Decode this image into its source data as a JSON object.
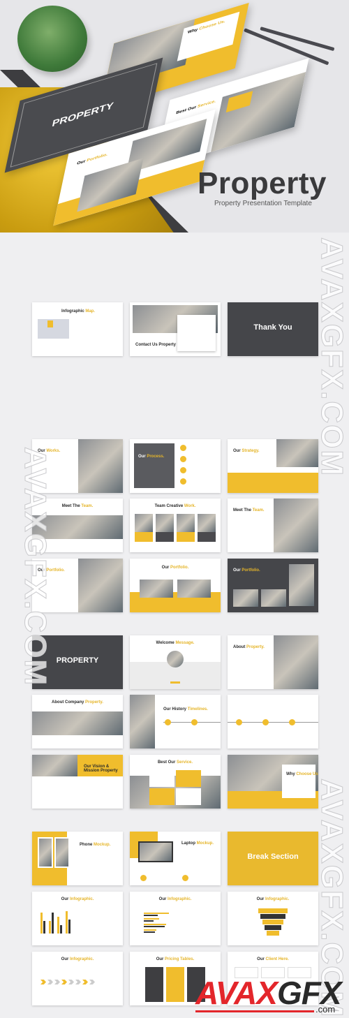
{
  "hero": {
    "title": "Property",
    "subtitle": "Property Presentation Template",
    "mockups": [
      {
        "title_a": "Why",
        "title_b": "Choose Us."
      },
      {
        "title_a": "Best Our",
        "title_b": "Service."
      },
      {
        "title_a": "PROPERTY",
        "title_b": ""
      },
      {
        "title_a": "Our",
        "title_b": "Portfolio."
      }
    ]
  },
  "colors": {
    "accent": "#f0bd2d",
    "dark": "#3f3f42",
    "watermark_red": "#e3262b"
  },
  "slides": [
    {
      "title_a": "Infographic",
      "title_b": "Map.",
      "layout": "map"
    },
    {
      "title_a": "Contact Us Property",
      "title_b": "",
      "layout": "contact"
    },
    {
      "title_a": "Thank You",
      "title_b": "",
      "layout": "dark"
    },
    {
      "title_a": "Our",
      "title_b": "Works.",
      "layout": "split-r"
    },
    {
      "title_a": "Our",
      "title_b": "Process.",
      "layout": "process"
    },
    {
      "title_a": "Our",
      "title_b": "Strategy.",
      "layout": "strategy"
    },
    {
      "title_a": "Meet The",
      "title_b": "Team.",
      "layout": "center-photo"
    },
    {
      "title_a": "Team Creative",
      "title_b": "Work.",
      "layout": "team"
    },
    {
      "title_a": "Meet The",
      "title_b": "Team.",
      "layout": "split-r"
    },
    {
      "title_a": "Our",
      "title_b": "Portfolio.",
      "layout": "split-r"
    },
    {
      "title_a": "Our",
      "title_b": "Portfolio.",
      "layout": "yellow-bottom"
    },
    {
      "title_a": "Our",
      "title_b": "Portfolio.",
      "layout": "dark-portfolio"
    },
    {
      "title_a": "PROPERTY",
      "title_b": "",
      "layout": "dark"
    },
    {
      "title_a": "Welcome",
      "title_b": "Message.",
      "layout": "welcome"
    },
    {
      "title_a": "About",
      "title_b": "Property.",
      "layout": "split-r"
    },
    {
      "title_a": "About Company",
      "title_b": "Property.",
      "layout": "center-photo"
    },
    {
      "title_a": "Our History",
      "title_b": "Timelines.",
      "layout": "timeline"
    },
    {
      "title_a": "",
      "title_b": "",
      "layout": "timeline2"
    },
    {
      "title_a": "Our Vision & Mission Property",
      "title_b": "",
      "layout": "vision"
    },
    {
      "title_a": "Best Our",
      "title_b": "Service.",
      "layout": "service"
    },
    {
      "title_a": "Why",
      "title_b": "Choose Us.",
      "layout": "why"
    },
    {
      "title_a": "Phone",
      "title_b": "Mockup.",
      "layout": "phone"
    },
    {
      "title_a": "Laptop",
      "title_b": "Mockup.",
      "layout": "laptop"
    },
    {
      "title_a": "Break Section",
      "title_b": "",
      "layout": "yellow"
    },
    {
      "title_a": "Our",
      "title_b": "Infographic.",
      "layout": "bars"
    },
    {
      "title_a": "Our",
      "title_b": "Infographic.",
      "layout": "hbars"
    },
    {
      "title_a": "Our",
      "title_b": "Infographic.",
      "layout": "funnel"
    },
    {
      "title_a": "Our",
      "title_b": "Infographic.",
      "layout": "arrows"
    },
    {
      "title_a": "Our",
      "title_b": "Pricing Tables.",
      "layout": "pricing"
    },
    {
      "title_a": "Our",
      "title_b": "Client Here.",
      "layout": "clients"
    }
  ],
  "watermark": {
    "text": "AVAXGFX.COM",
    "logo_a": "AVAX",
    "logo_b": "GFX",
    "logo_c": ".com"
  }
}
